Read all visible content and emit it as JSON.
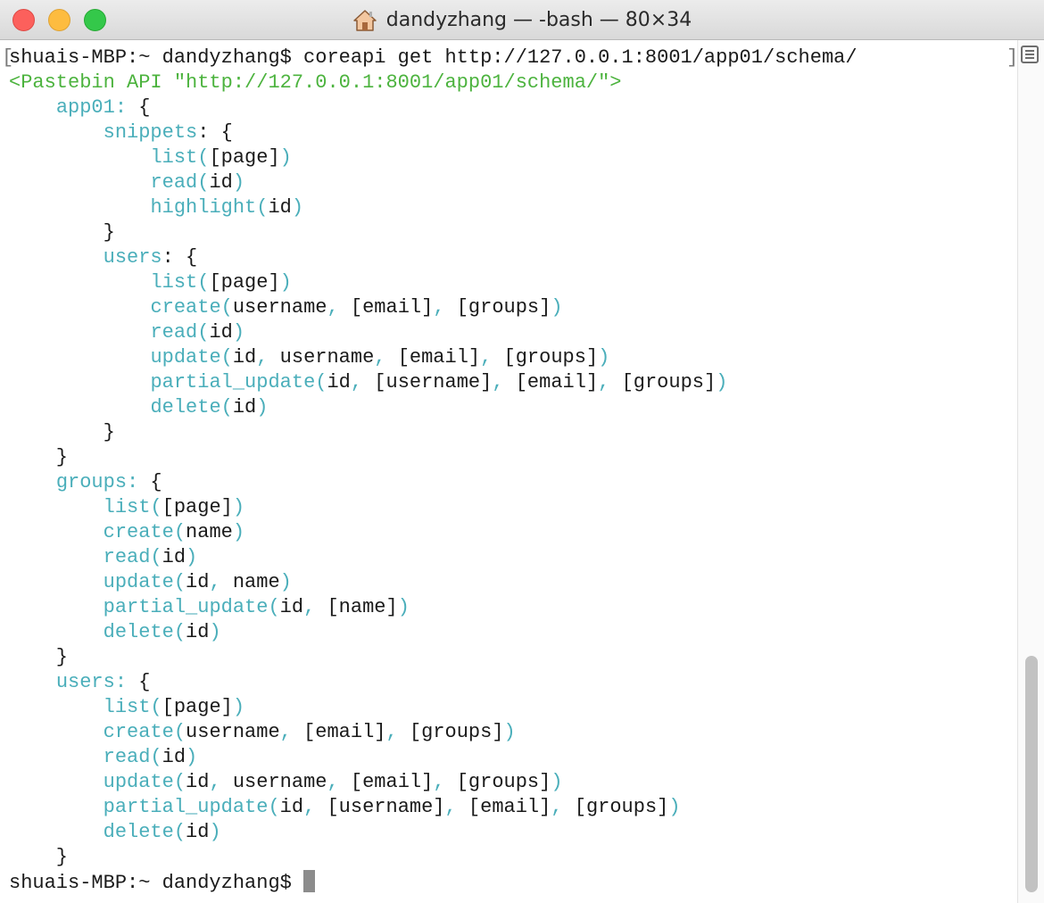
{
  "window": {
    "title": "dandyzhang — -bash — 80×34",
    "title_icon": "home-icon"
  },
  "colors": {
    "prompt": "#1a1a1a",
    "api_header": "#4cb33e",
    "identifier": "#4aaeba",
    "punctuation": "#1a1a1a"
  },
  "terminal": {
    "line_0": {
      "seg_0": "shuais-MBP:~ dandyzhang$ coreapi get http://127.0.0.1:8001/app01/schema/"
    },
    "line_1": {
      "seg_0": "<Pastebin API \"http://127.0.0.1:8001/app01/schema/\">"
    },
    "line_2": {
      "seg_0": "    ",
      "seg_1": "app01:",
      "seg_2": " {"
    },
    "line_3": {
      "seg_0": "        ",
      "seg_1": "snippets",
      "seg_2": ": {"
    },
    "line_4": {
      "seg_0": "            ",
      "seg_1": "list(",
      "seg_2": "[page]",
      "seg_3": ")"
    },
    "line_5": {
      "seg_0": "            ",
      "seg_1": "read(",
      "seg_2": "id",
      "seg_3": ")"
    },
    "line_6": {
      "seg_0": "            ",
      "seg_1": "highlight(",
      "seg_2": "id",
      "seg_3": ")"
    },
    "line_7": {
      "seg_0": "        }"
    },
    "line_8": {
      "seg_0": "        ",
      "seg_1": "users",
      "seg_2": ": {"
    },
    "line_9": {
      "seg_0": "            ",
      "seg_1": "list(",
      "seg_2": "[page]",
      "seg_3": ")"
    },
    "line_10": {
      "seg_0": "            ",
      "seg_1": "create(",
      "seg_2": "username",
      "seg_3": ", ",
      "seg_4": "[email]",
      "seg_5": ", ",
      "seg_6": "[groups]",
      "seg_7": ")"
    },
    "line_11": {
      "seg_0": "            ",
      "seg_1": "read(",
      "seg_2": "id",
      "seg_3": ")"
    },
    "line_12": {
      "seg_0": "            ",
      "seg_1": "update(",
      "seg_2": "id",
      "seg_3": ", ",
      "seg_4": "username",
      "seg_5": ", ",
      "seg_6": "[email]",
      "seg_7": ", ",
      "seg_8": "[groups]",
      "seg_9": ")"
    },
    "line_13": {
      "seg_0": "            ",
      "seg_1": "partial_update(",
      "seg_2": "id",
      "seg_3": ", ",
      "seg_4": "[username]",
      "seg_5": ", ",
      "seg_6": "[email]",
      "seg_7": ", ",
      "seg_8": "[groups]",
      "seg_9": ")"
    },
    "line_14": {
      "seg_0": "            ",
      "seg_1": "delete(",
      "seg_2": "id",
      "seg_3": ")"
    },
    "line_15": {
      "seg_0": "        }"
    },
    "line_16": {
      "seg_0": "    }"
    },
    "line_17": {
      "seg_0": "    ",
      "seg_1": "groups:",
      "seg_2": " {"
    },
    "line_18": {
      "seg_0": "        ",
      "seg_1": "list(",
      "seg_2": "[page]",
      "seg_3": ")"
    },
    "line_19": {
      "seg_0": "        ",
      "seg_1": "create(",
      "seg_2": "name",
      "seg_3": ")"
    },
    "line_20": {
      "seg_0": "        ",
      "seg_1": "read(",
      "seg_2": "id",
      "seg_3": ")"
    },
    "line_21": {
      "seg_0": "        ",
      "seg_1": "update(",
      "seg_2": "id",
      "seg_3": ", ",
      "seg_4": "name",
      "seg_5": ")"
    },
    "line_22": {
      "seg_0": "        ",
      "seg_1": "partial_update(",
      "seg_2": "id",
      "seg_3": ", ",
      "seg_4": "[name]",
      "seg_5": ")"
    },
    "line_23": {
      "seg_0": "        ",
      "seg_1": "delete(",
      "seg_2": "id",
      "seg_3": ")"
    },
    "line_24": {
      "seg_0": "    }"
    },
    "line_25": {
      "seg_0": "    ",
      "seg_1": "users:",
      "seg_2": " {"
    },
    "line_26": {
      "seg_0": "        ",
      "seg_1": "list(",
      "seg_2": "[page]",
      "seg_3": ")"
    },
    "line_27": {
      "seg_0": "        ",
      "seg_1": "create(",
      "seg_2": "username",
      "seg_3": ", ",
      "seg_4": "[email]",
      "seg_5": ", ",
      "seg_6": "[groups]",
      "seg_7": ")"
    },
    "line_28": {
      "seg_0": "        ",
      "seg_1": "read(",
      "seg_2": "id",
      "seg_3": ")"
    },
    "line_29": {
      "seg_0": "        ",
      "seg_1": "update(",
      "seg_2": "id",
      "seg_3": ", ",
      "seg_4": "username",
      "seg_5": ", ",
      "seg_6": "[email]",
      "seg_7": ", ",
      "seg_8": "[groups]",
      "seg_9": ")"
    },
    "line_30": {
      "seg_0": "        ",
      "seg_1": "partial_update(",
      "seg_2": "id",
      "seg_3": ", ",
      "seg_4": "[username]",
      "seg_5": ", ",
      "seg_6": "[email]",
      "seg_7": ", ",
      "seg_8": "[groups]",
      "seg_9": ")"
    },
    "line_31": {
      "seg_0": "        ",
      "seg_1": "delete(",
      "seg_2": "id",
      "seg_3": ")"
    },
    "line_32": {
      "seg_0": "    }"
    },
    "line_33": {
      "seg_0": "shuais-MBP:~ dandyzhang$ "
    }
  }
}
